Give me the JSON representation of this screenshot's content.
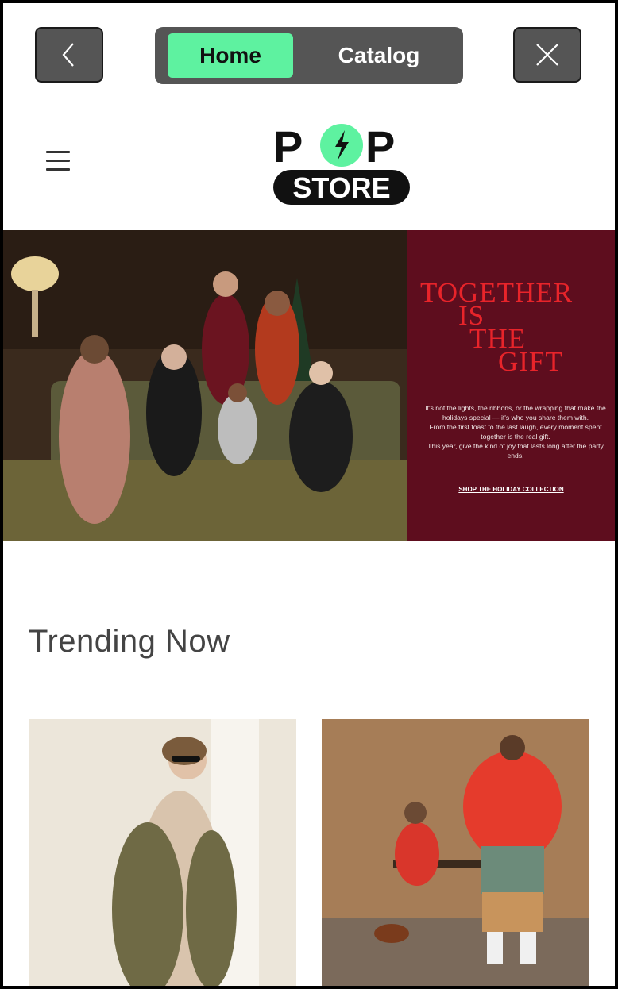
{
  "nav": {
    "tabs": [
      {
        "label": "Home",
        "active": true
      },
      {
        "label": "Catalog",
        "active": false
      }
    ],
    "back_icon": "chevron-left-icon",
    "close_icon": "close-icon"
  },
  "header": {
    "menu_icon": "hamburger-menu-icon",
    "logo_text_top": "P",
    "logo_text_top_right": "P",
    "logo_text_bottom": "STORE"
  },
  "hero": {
    "title_lines": [
      "TOGETHER",
      "IS",
      "THE",
      "GIFT"
    ],
    "body_lines": [
      "It's not the lights, the ribbons, or the wrapping that make the holidays special — it's who you share them with.",
      "From the first toast to the last laugh, every moment spent together is the real gift.",
      "This year, give the kind of joy that lasts long after the party ends."
    ],
    "cta": "SHOP THE HOLIDAY COLLECTION"
  },
  "trending": {
    "title": "Trending Now"
  },
  "colors": {
    "accent_green": "#5ef2a0",
    "hero_panel": "#5e0d1e",
    "hero_title": "#e8242a"
  }
}
